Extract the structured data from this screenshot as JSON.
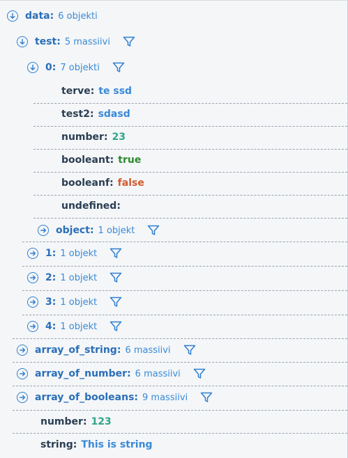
{
  "tree": {
    "data": {
      "key": "data",
      "summary": "6 objekti"
    },
    "test": {
      "key": "test",
      "summary": "5 massiivi"
    },
    "item0": {
      "key": "0",
      "summary": "7 objekti"
    },
    "item0_fields": {
      "terve": {
        "key": "terve",
        "value": "te ssd"
      },
      "test2": {
        "key": "test2",
        "value": "sdasd"
      },
      "number": {
        "key": "number",
        "value": "23"
      },
      "booleant": {
        "key": "booleant",
        "value": "true"
      },
      "booleanf": {
        "key": "booleanf",
        "value": "false"
      },
      "undefined": {
        "key": "undefined",
        "value": ""
      }
    },
    "item0_object": {
      "key": "object",
      "summary": "1 objekt"
    },
    "item1": {
      "key": "1",
      "summary": "1 objekt"
    },
    "item2": {
      "key": "2",
      "summary": "1 objekt"
    },
    "item3": {
      "key": "3",
      "summary": "1 objekt"
    },
    "item4": {
      "key": "4",
      "summary": "1 objekt"
    },
    "array_of_string": {
      "key": "array_of_string",
      "summary": "6 massiivi"
    },
    "array_of_number": {
      "key": "array_of_number",
      "summary": "6 massiivi"
    },
    "array_of_booleans": {
      "key": "array_of_booleans",
      "summary": "9 massiivi"
    },
    "number": {
      "key": "number",
      "value": "123"
    },
    "string": {
      "key": "string",
      "value": "This is string"
    }
  },
  "icons": {
    "expanded": "arrow-down-circle-icon",
    "collapsed": "arrow-right-circle-icon",
    "filter": "filter-icon"
  },
  "colors": {
    "key": "#2a6fb8",
    "summary": "#3a8ad6",
    "string": "#3a8ad6",
    "number": "#2fa58a",
    "true": "#2c8a2c",
    "false": "#d05a2c"
  }
}
